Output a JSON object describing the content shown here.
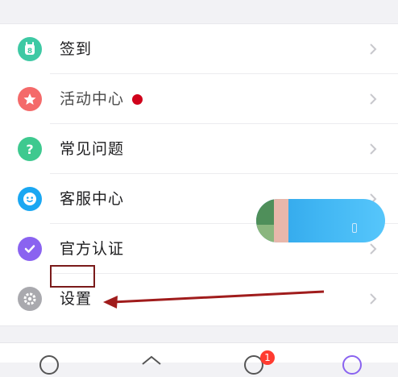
{
  "menu": {
    "items": [
      {
        "label": "签到",
        "icon": "calendar-icon",
        "color": "#3ec9a4"
      },
      {
        "label": "活动中心",
        "icon": "star-icon",
        "color": "#f46a6a",
        "has_dot": true
      },
      {
        "label": "常见问题",
        "icon": "question-icon",
        "color": "#3ec98f"
      },
      {
        "label": "客服中心",
        "icon": "smile-icon",
        "color": "#1aa7f2"
      },
      {
        "label": "官方认证",
        "icon": "check-icon",
        "color": "#8a63f0"
      },
      {
        "label": "设置",
        "icon": "gear-icon",
        "color": "#a9a9ae"
      }
    ]
  },
  "tabs": {
    "badge_count": "1"
  },
  "colors": {
    "arrow": "#a01c1c",
    "highlight_box": "#7a1a1a",
    "red_dot": "#d0021b"
  }
}
